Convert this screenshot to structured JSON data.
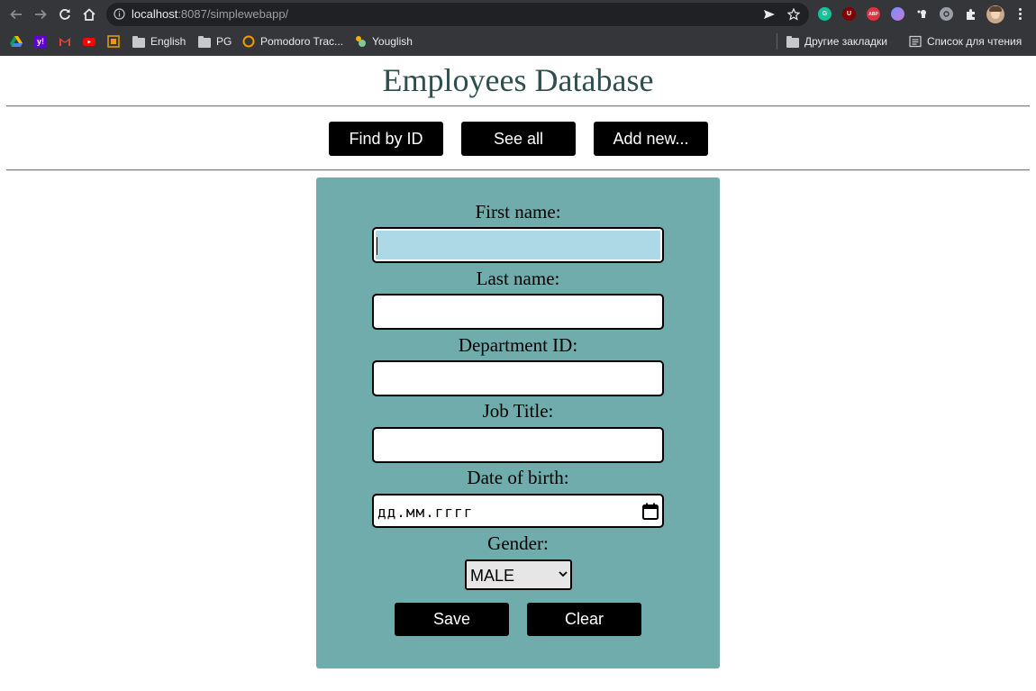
{
  "browser": {
    "url_host": "localhost",
    "url_rest": ":8087/simplewebapp/",
    "extensions": [
      {
        "name": "grammarly-icon",
        "label": "G",
        "color": "#15c39a"
      },
      {
        "name": "ublock-icon",
        "label": "U",
        "color": "#800000"
      },
      {
        "name": "adblock-icon",
        "label": "ABP",
        "color": "#e0323f"
      }
    ],
    "bookmarks": {
      "english": "English",
      "pg": "PG",
      "pomodoro": "Pomodoro Trac...",
      "youglish": "Youglish",
      "other": "Другие закладки",
      "reading_list": "Список для чтения"
    }
  },
  "page": {
    "title": "Employees Database",
    "nav": {
      "find_by_id": "Find by ID",
      "see_all": "See all",
      "add_new": "Add new..."
    },
    "form": {
      "first_name_label": "First name:",
      "first_name_value": "",
      "last_name_label": "Last name:",
      "last_name_value": "",
      "department_label": "Department ID:",
      "department_value": "",
      "job_title_label": "Job Title:",
      "job_title_value": "",
      "dob_label": "Date of birth:",
      "dob_placeholder": "дд.мм.гггг",
      "gender_label": "Gender:",
      "gender_selected": "MALE",
      "save_label": "Save",
      "clear_label": "Clear"
    }
  },
  "colors": {
    "title": "#2f4f4f",
    "panel": "#70acac",
    "focused_input": "#add8e6",
    "button": "#000000"
  }
}
